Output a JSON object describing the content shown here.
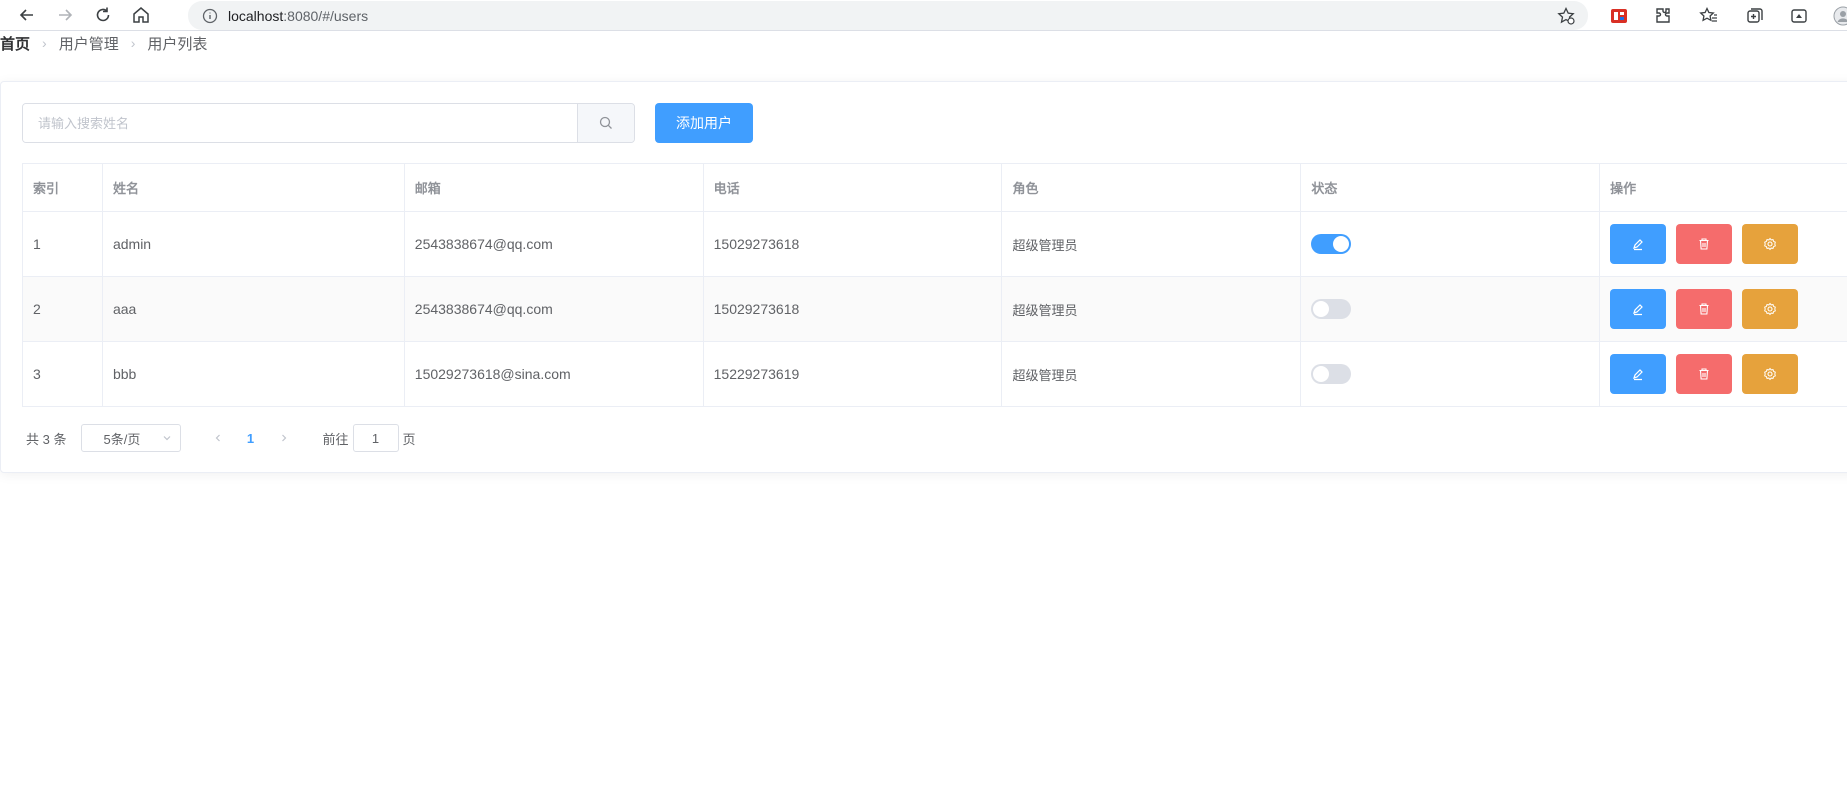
{
  "browser": {
    "url_host": "localhost",
    "url_rest": ":8080/#/users",
    "icons": [
      "back-icon",
      "forward-icon",
      "reload-icon",
      "home-icon",
      "info-icon",
      "favorite-add-icon",
      "extension-icon",
      "puzzle-icon",
      "favorites-icon",
      "collections-icon",
      "screenshot-icon",
      "profile-icon"
    ]
  },
  "breadcrumb": {
    "items": [
      "首页",
      "用户管理",
      "用户列表"
    ]
  },
  "toolbar": {
    "search_placeholder": "请输入搜索姓名",
    "search_value": "",
    "add_label": "添加用户"
  },
  "table": {
    "headers": [
      "索引",
      "姓名",
      "邮箱",
      "电话",
      "角色",
      "状态",
      "操作"
    ],
    "rows": [
      {
        "index": "1",
        "name": "admin",
        "email": "2543838674@qq.com",
        "phone": "15029273618",
        "role": "超级管理员",
        "status": true
      },
      {
        "index": "2",
        "name": "aaa",
        "email": "2543838674@qq.com",
        "phone": "15029273618",
        "role": "超级管理员",
        "status": false
      },
      {
        "index": "3",
        "name": "bbb",
        "email": "15029273618@sina.com",
        "phone": "15229273619",
        "role": "超级管理员",
        "status": false
      }
    ]
  },
  "pagination": {
    "total_prefix": "共",
    "total": "3",
    "total_suffix": "条",
    "page_size": "5条/页",
    "current_page": "1",
    "jump_prefix": "前往",
    "jump_value": "1",
    "jump_suffix": "页"
  },
  "colors": {
    "primary": "#409eff",
    "danger": "#f56c6c",
    "warning": "#e6a23c"
  }
}
